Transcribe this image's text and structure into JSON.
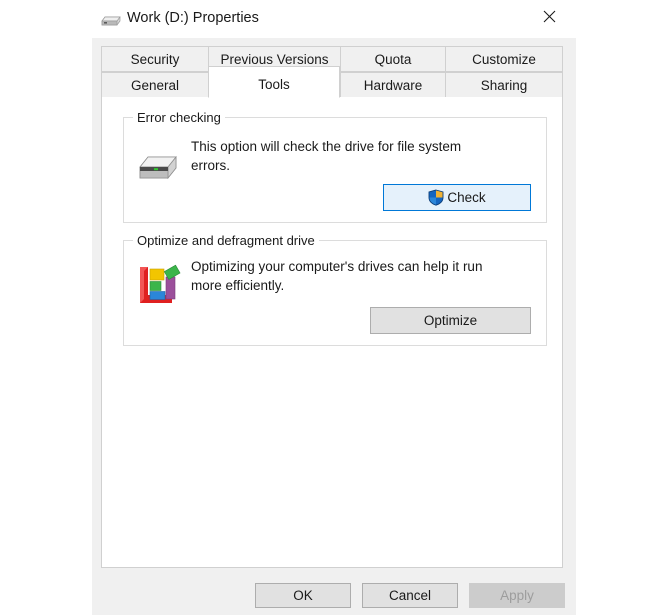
{
  "window": {
    "title": "Work (D:) Properties",
    "icon": "hard-drive-icon",
    "close_label": "✕"
  },
  "tabs": {
    "row1": [
      {
        "label": "Security",
        "active": false
      },
      {
        "label": "Previous Versions",
        "active": false
      },
      {
        "label": "Quota",
        "active": false
      },
      {
        "label": "Customize",
        "active": false
      }
    ],
    "row2": [
      {
        "label": "General",
        "active": false
      },
      {
        "label": "Tools",
        "active": true
      },
      {
        "label": "Hardware",
        "active": false
      },
      {
        "label": "Sharing",
        "active": false
      }
    ]
  },
  "error_checking": {
    "group_title": "Error checking",
    "description": "This option will check the drive for file system errors.",
    "icon": "hard-drive-icon",
    "button_label": "Check",
    "button_icon": "uac-shield-icon",
    "button_focused": true
  },
  "optimize": {
    "group_title": "Optimize and defragment drive",
    "description": "Optimizing your computer's drives can help it run more efficiently.",
    "icon": "defragment-icon",
    "button_label": "Optimize",
    "button_focused": false
  },
  "footer": {
    "ok_label": "OK",
    "cancel_label": "Cancel",
    "apply_label": "Apply",
    "apply_disabled": true
  },
  "colors": {
    "accent_blue": "#0078d7",
    "focus_fill": "#e5f1fb",
    "dialog_bg": "#f0f0f0",
    "panel_bg": "#ffffff",
    "button_face": "#e1e1e1",
    "disabled_text": "#9d9d9d"
  }
}
